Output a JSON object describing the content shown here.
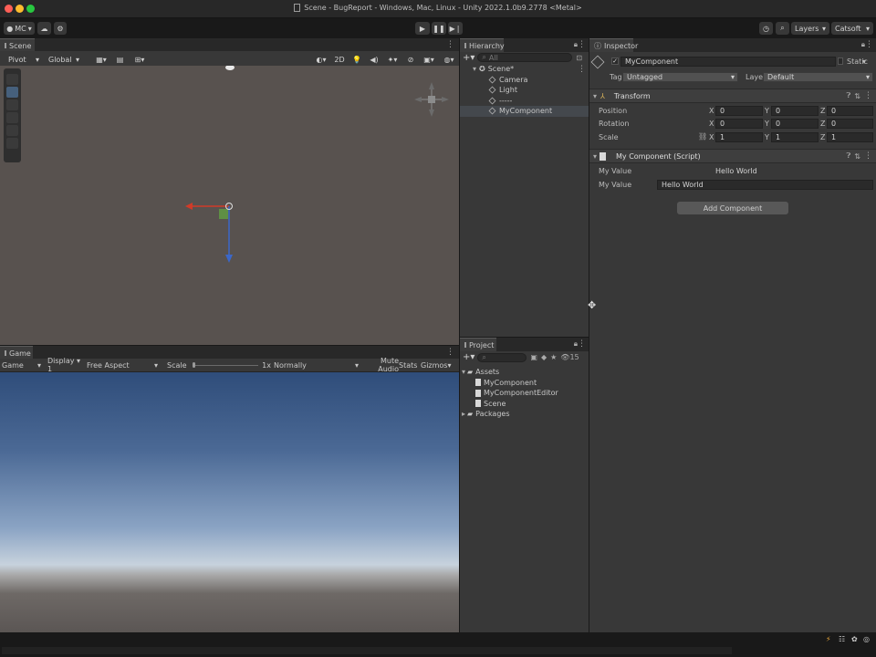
{
  "window": {
    "title": "Scene - BugReport - Windows, Mac, Linux - Unity 2022.1.0b9.2778 <Metal>",
    "colors": {
      "close": "#fe5f57",
      "minimize": "#febc2e",
      "zoom": "#28c840",
      "accent_blue": "#4a90d9",
      "selection": "#44484d"
    }
  },
  "toolbar": {
    "account": "MC",
    "layers": "Layers",
    "layout": "Catsoft"
  },
  "scene_panel": {
    "tab": "Scene",
    "pivot": "Pivot",
    "global": "Global",
    "mode_2d": "2D"
  },
  "game_panel": {
    "tab": "Game",
    "mode": "Game",
    "display": "Display 1",
    "aspect": "Free Aspect",
    "scale_label": "Scale",
    "scale_value": "1x",
    "play_mode": "Normally",
    "mute": "Mute Audio",
    "stats": "Stats",
    "gizmos": "Gizmos"
  },
  "hierarchy": {
    "tab": "Hierarchy",
    "search_placeholder": "All",
    "items": [
      {
        "label": "Scene*",
        "level": 0
      },
      {
        "label": "Camera",
        "level": 1
      },
      {
        "label": "Light",
        "level": 1
      },
      {
        "label": "-----",
        "level": 1
      },
      {
        "label": "MyComponent",
        "level": 1
      }
    ]
  },
  "project": {
    "tab": "Project",
    "hidden_count": "15",
    "folders": [
      {
        "label": "Assets",
        "children": [
          "MyComponent",
          "MyComponentEditor",
          "Scene"
        ]
      },
      {
        "label": "Packages",
        "children": []
      }
    ]
  },
  "inspector": {
    "tab": "Inspector",
    "object_name": "MyComponent",
    "static_label": "Static",
    "tag_label": "Tag",
    "tag_value": "Untagged",
    "layer_label": "Layer",
    "layer_value": "Default",
    "transform": {
      "title": "Transform",
      "position_label": "Position",
      "rotation_label": "Rotation",
      "scale_label": "Scale",
      "position": [
        "0",
        "0",
        "0"
      ],
      "rotation": [
        "0",
        "0",
        "0"
      ],
      "scale": [
        "1",
        "1",
        "1"
      ],
      "axis_x": "X",
      "axis_y": "Y",
      "axis_z": "Z"
    },
    "script": {
      "title": "My Component (Script)",
      "field1_label": "My Value",
      "field1_value": "Hello World",
      "field2_label": "My Value",
      "field2_value": "Hello World"
    },
    "add_component": "Add Component"
  }
}
